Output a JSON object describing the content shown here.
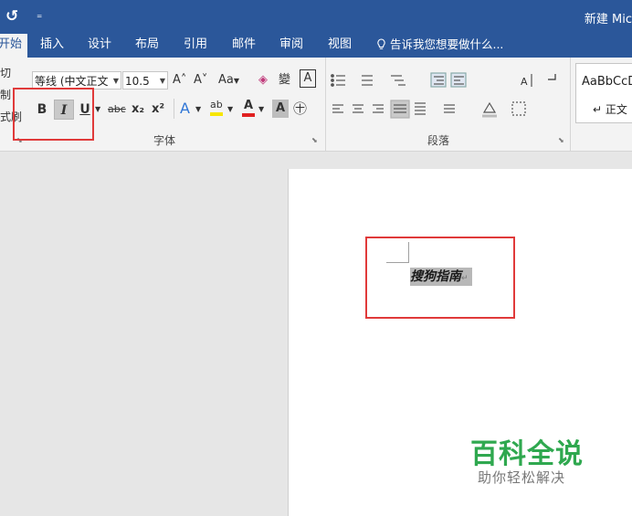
{
  "titlebar": {
    "undo_icon": "↺",
    "qat_arrow": "₌",
    "doc_title": "新建 Mic"
  },
  "tabs": [
    {
      "label": "开始",
      "active": true
    },
    {
      "label": "插入"
    },
    {
      "label": "设计"
    },
    {
      "label": "布局"
    },
    {
      "label": "引用"
    },
    {
      "label": "邮件"
    },
    {
      "label": "审阅"
    },
    {
      "label": "视图"
    }
  ],
  "tellme": {
    "icon": "lightbulb-icon",
    "text": "告诉我您想要做什么..."
  },
  "clipboard": {
    "cut": "切",
    "copy": "制",
    "painter": "式刷"
  },
  "font": {
    "name": "等线 (中文正文",
    "size": "10.5",
    "group_label": "字体",
    "bold": "B",
    "italic": "I",
    "underline": "U",
    "strikethrough": "abc",
    "subscript": "x₂",
    "superscript": "x²",
    "grow": "A˄",
    "shrink": "A˅",
    "case": "Aa",
    "clear": "◈",
    "phonetic": "變",
    "border_char": "A",
    "effects": "A",
    "highlight": "ab",
    "font_color": "A",
    "shading": "A",
    "enclose": "㊉"
  },
  "paragraph": {
    "group_label": "段落"
  },
  "styles": {
    "sample": "AaBbCcD",
    "normal": "↵ 正文"
  },
  "document": {
    "selected_text": "搜狗指南",
    "pilcrow": "↵"
  },
  "watermark": {
    "title": "百科全说",
    "subtitle": "助你轻松解决"
  },
  "colors": {
    "ribbon_blue": "#2b579a",
    "annotation_red": "#e03a3a",
    "watermark_green": "#2fa84f"
  }
}
